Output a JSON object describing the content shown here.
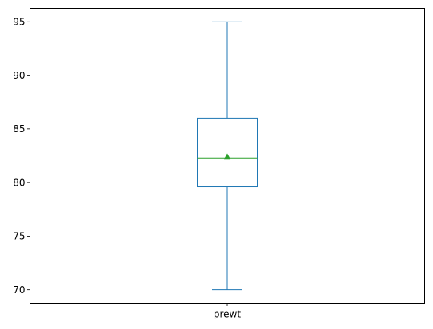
{
  "chart_data": {
    "type": "box",
    "categories": [
      "prewt"
    ],
    "boxes": [
      {
        "name": "prewt",
        "whisker_low": 70.0,
        "q1": 79.6,
        "median": 82.3,
        "q3": 86.0,
        "whisker_high": 95.0,
        "mean": 82.4
      }
    ],
    "ylim": [
      68.75,
      96.25
    ],
    "yticks": [
      70,
      75,
      80,
      85,
      90,
      95
    ],
    "title": "",
    "xlabel": "",
    "ylabel": "",
    "grid": false,
    "colors": {
      "box": "#1f77b4",
      "median": "#2ca02c",
      "mean_marker": "#2ca02c",
      "axes": "#000000"
    },
    "mean_marker_shape": "triangle"
  }
}
